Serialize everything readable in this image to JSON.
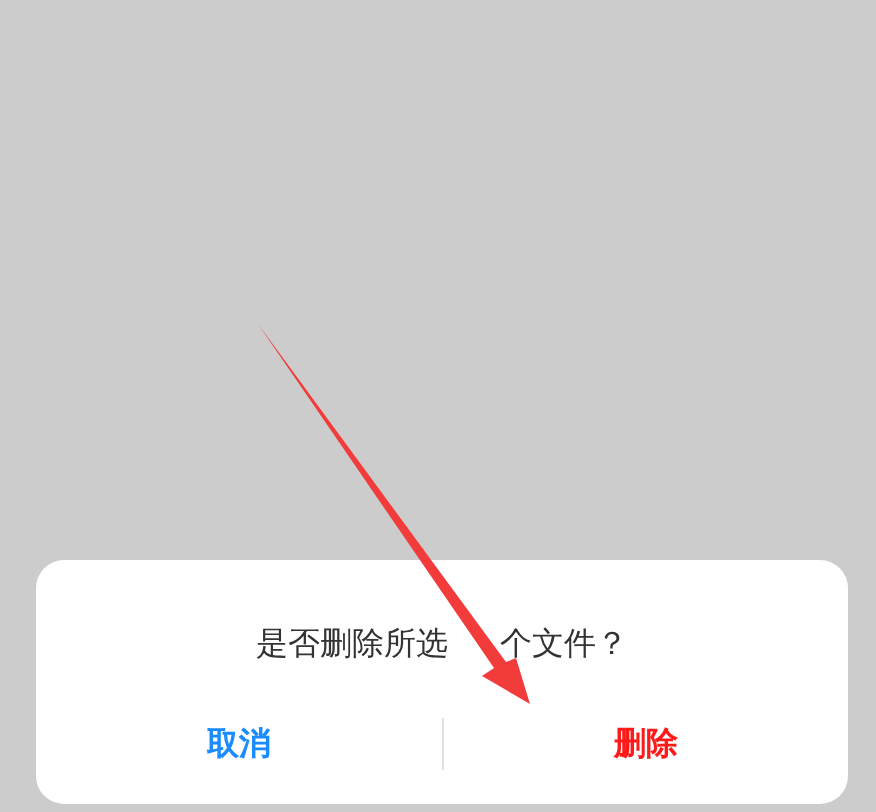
{
  "dialog": {
    "message_parts": [
      "是否删除所选",
      "个文件？"
    ],
    "buttons": [
      {
        "label": "取消",
        "kind": "cancel"
      },
      {
        "label": "删除",
        "kind": "destructive"
      }
    ]
  }
}
